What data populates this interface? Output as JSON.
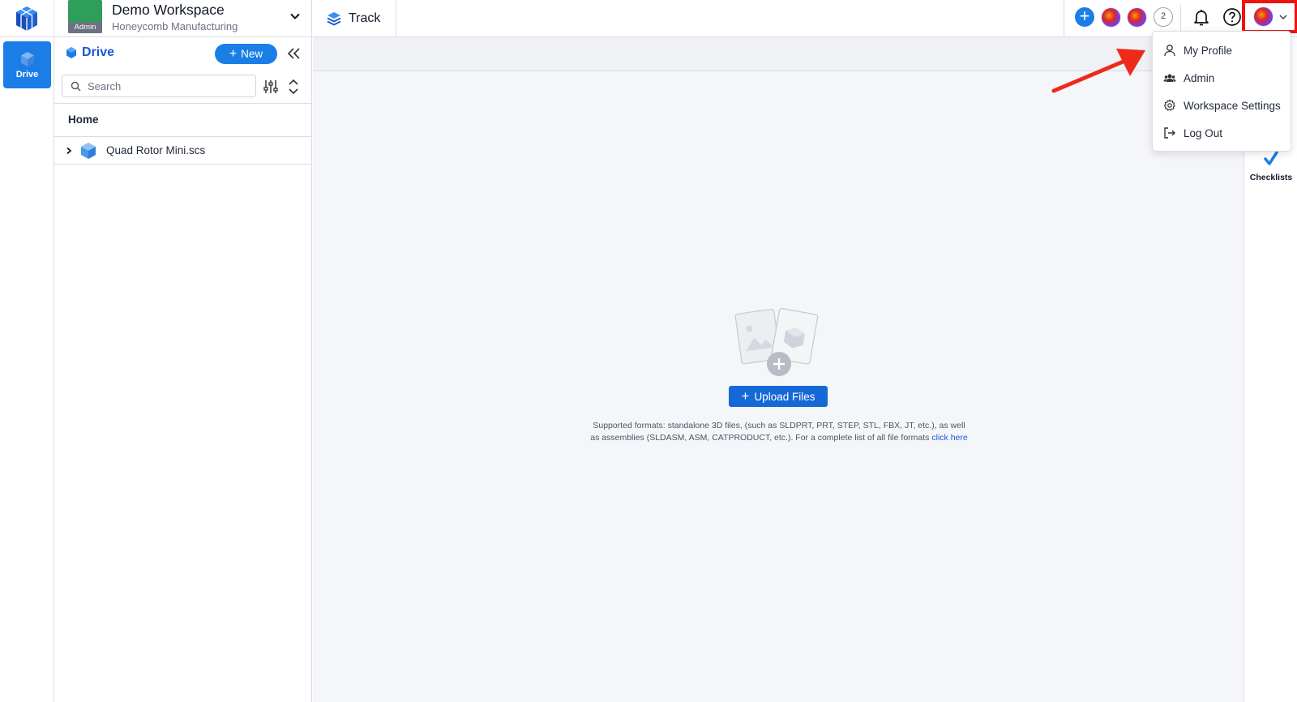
{
  "header": {
    "workspace_name": "Demo Workspace",
    "workspace_org": "Honeycomb Manufacturing",
    "workspace_badge": "Admin",
    "active_tab": "Track",
    "collaborator_overflow_count": "2"
  },
  "rail": {
    "drive_label": "Drive"
  },
  "drive_panel": {
    "title": "Drive",
    "new_button": "New",
    "search_placeholder": "Search",
    "breadcrumb": "Home",
    "files": [
      {
        "name": "Quad Rotor Mini.scs",
        "icon": "cube-icon",
        "expandable": true
      }
    ]
  },
  "main": {
    "upload_button": "Upload Files",
    "formats_text": "Supported formats: standalone 3D files, (such as SLDPRT, PRT, STEP, STL, FBX, JT, etc.), as well as assemblies (SLDASM, ASM, CATPRODUCT, etc.). For a complete list of all file formats",
    "formats_link": "click here"
  },
  "right_rail": {
    "checklists_label": "Checklists"
  },
  "profile_menu": {
    "items": [
      {
        "label": "My Profile",
        "icon": "person-icon"
      },
      {
        "label": "Admin",
        "icon": "users-icon"
      },
      {
        "label": "Workspace Settings",
        "icon": "gear-icon"
      },
      {
        "label": "Log Out",
        "icon": "logout-icon"
      }
    ]
  },
  "colors": {
    "primary": "#1a7ee6",
    "highlight_box": "#ee1212",
    "annotation_arrow": "#ee2a1a",
    "workspace_thumb": "#2f9e5a"
  }
}
